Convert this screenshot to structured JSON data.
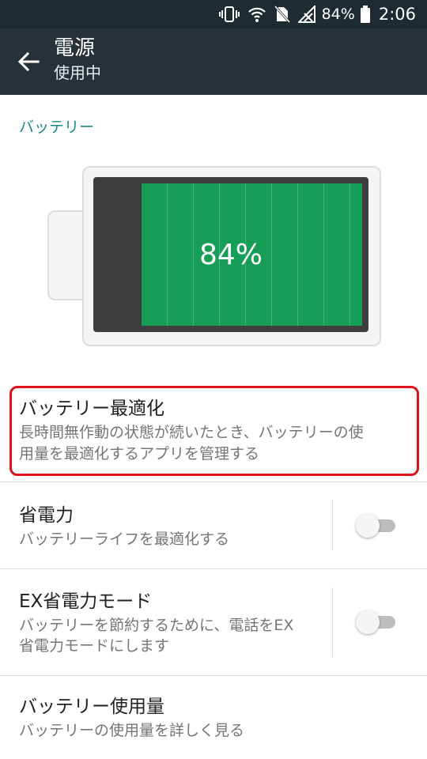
{
  "status_bar": {
    "battery_text": "84%",
    "time": "2:06",
    "icons": [
      "vibrate-icon",
      "wifi-icon",
      "no-sim-icon",
      "no-signal-icon",
      "battery-icon"
    ]
  },
  "app_bar": {
    "title": "電源",
    "subtitle": "使用中"
  },
  "battery_section": {
    "header": "バッテリー",
    "percent_text": "84%",
    "level": 0.84,
    "fill_color": "#169d56"
  },
  "settings": [
    {
      "title": "バッテリー最適化",
      "desc_lines": [
        "長時間無作動の状態が続いたとき、バッテリーの使",
        "用量を最適化するアプリを管理する"
      ],
      "highlighted": true
    },
    {
      "title": "省電力",
      "desc_lines": [
        "バッテリーライフを最適化する"
      ],
      "toggle": false
    },
    {
      "title": "EX省電力モード",
      "desc_lines": [
        "バッテリーを節約するために、電話をEX",
        "省電力モードにします"
      ],
      "toggle": false
    },
    {
      "title": "バッテリー使用量",
      "desc_lines": [
        "バッテリーの使用量を詳しく見る"
      ]
    }
  ],
  "colors": {
    "accent": "#1a8a84",
    "app_bar": "#263238",
    "status_bar": "#1e2b30",
    "highlight_border": "#e0101a"
  }
}
